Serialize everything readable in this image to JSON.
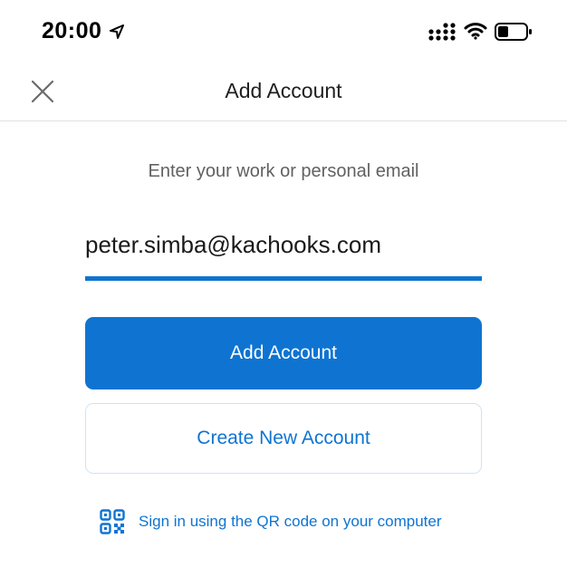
{
  "status_bar": {
    "time": "20:00",
    "icons": [
      "location-arrow-icon",
      "cellular-signal-icon",
      "wifi-icon",
      "battery-icon"
    ]
  },
  "nav": {
    "title": "Add Account",
    "close_icon": "close-icon"
  },
  "form": {
    "prompt": "Enter your work or personal email",
    "email_value": "peter.simba@kachooks.com",
    "add_account_label": "Add Account",
    "create_account_label": "Create New Account",
    "qr_label": "Sign in using the QR code on your computer",
    "qr_icon": "qr-code-icon"
  },
  "colors": {
    "accent": "#0f74d1",
    "text_primary": "#1f1f1f",
    "text_secondary": "#616161",
    "divider": "#e1e1e1",
    "outline_button_border": "#cfe3f3"
  }
}
